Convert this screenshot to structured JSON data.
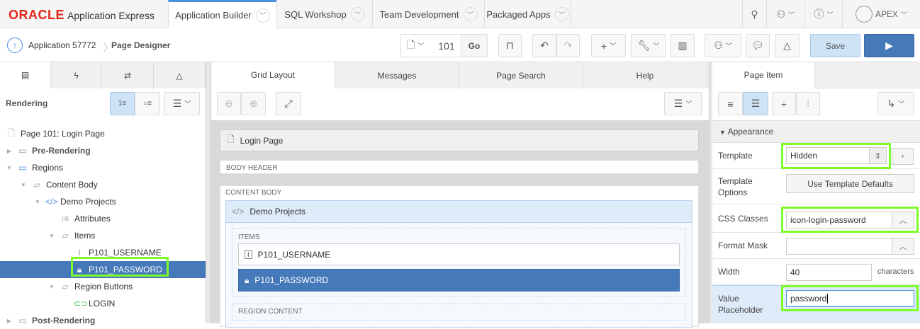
{
  "topnav": {
    "logo_brand": "ORACLE",
    "logo_product": "Application Express",
    "tabs": [
      {
        "label": "Application Builder",
        "active": true
      },
      {
        "label": "SQL Workshop"
      },
      {
        "label": "Team Development"
      },
      {
        "label": "Packaged Apps"
      }
    ],
    "user": "APEX"
  },
  "breadcrumb": {
    "app": "Application 57772",
    "page": "Page Designer"
  },
  "toolbar": {
    "page_number": "101",
    "go": "Go",
    "save": "Save"
  },
  "left": {
    "title": "Rendering",
    "tree": [
      {
        "label": "Page 101: Login Page",
        "icon": "page-icon",
        "level": 0
      },
      {
        "label": "Pre-Rendering",
        "icon": "folder-icon",
        "level": 0,
        "toggle": "▶",
        "bold": true
      },
      {
        "label": "Regions",
        "icon": "region-icon",
        "level": 0,
        "toggle": "▼"
      },
      {
        "label": "Content Body",
        "icon": "folder-open-icon",
        "level": 1,
        "toggle": "▼"
      },
      {
        "label": "Demo Projects",
        "icon": "code-icon",
        "level": 2,
        "toggle": "▼"
      },
      {
        "label": "Attributes",
        "icon": "list-icon",
        "level": 3
      },
      {
        "label": "Items",
        "icon": "folder-open-icon",
        "level": 3,
        "toggle": "▼"
      },
      {
        "label": "P101_USERNAME",
        "icon": "text-field-icon",
        "level": 4
      },
      {
        "label": "P101_PASSWORD",
        "icon": "lock-icon",
        "level": 4,
        "selected": true
      },
      {
        "label": "Region Buttons",
        "icon": "folder-open-icon",
        "level": 3,
        "toggle": "▼"
      },
      {
        "label": "LOGIN",
        "icon": "button-icon",
        "level": 4
      },
      {
        "label": "Post-Rendering",
        "icon": "folder-icon",
        "level": 0,
        "toggle": "▶",
        "bold": true
      }
    ]
  },
  "center": {
    "tabs": [
      "Grid Layout",
      "Messages",
      "Page Search",
      "Help"
    ],
    "page_title": "Login Page",
    "body_header": "BODY HEADER",
    "content_body": "CONTENT BODY",
    "region": "Demo Projects",
    "items_label": "ITEMS",
    "items": [
      "P101_USERNAME",
      "P101_PASSWORD"
    ],
    "region_content": "REGION CONTENT"
  },
  "right": {
    "tab": "Page Item",
    "section": "Appearance",
    "props": {
      "template_label": "Template",
      "template_value": "Hidden",
      "template_options_label": "Template Options",
      "template_options_button": "Use Template Defaults",
      "css_label": "CSS Classes",
      "css_value": "icon-login-password",
      "format_label": "Format Mask",
      "format_value": "",
      "width_label": "Width",
      "width_value": "40",
      "width_unit": "characters",
      "placeholder_label": "Value Placeholder",
      "placeholder_value": "password"
    }
  },
  "colors": {
    "accent": "#4579b9",
    "highlight": "#7dfb2a",
    "save_bg": "#cfe3f7"
  }
}
